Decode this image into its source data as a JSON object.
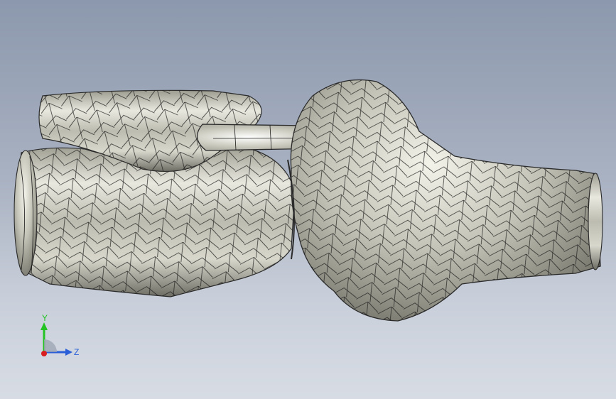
{
  "viewport": {
    "background_top": "#8c98ad",
    "background_bottom": "#d7dce4"
  },
  "model": {
    "part": "knee-joint-mesh",
    "surface_color": "#c9c8bc",
    "mesh_line_color": "#1a1a1a"
  },
  "triad": {
    "y_label": "Y",
    "z_label": "Z",
    "y_color": "#22c322",
    "z_color": "#2a5fd8",
    "x_color": "#d81e1e"
  }
}
